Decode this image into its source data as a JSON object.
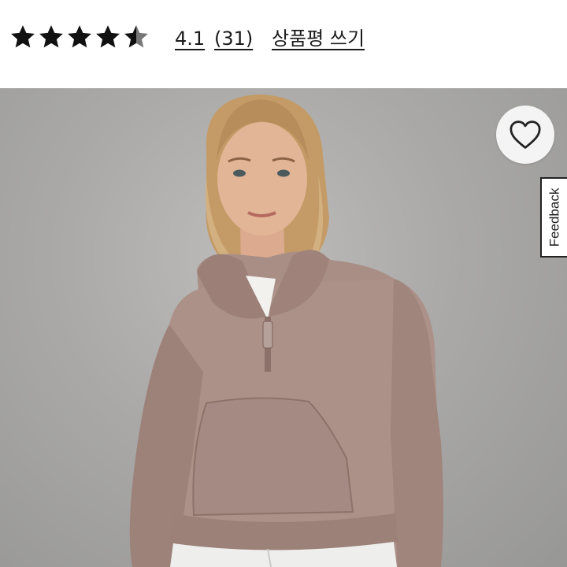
{
  "rating": {
    "value": 4.5,
    "max": 5,
    "average_label": "4.1",
    "count_label": "(31)",
    "write_review_label": "상품평 쓰기",
    "star_color": "#111111",
    "star_empty_color": "#777777"
  },
  "product_image": {
    "wishlist_icon": "heart-outline-icon",
    "feedback_label": "Feedback",
    "background_color": "#aaa9a7",
    "garment_color": "#a98e86"
  }
}
